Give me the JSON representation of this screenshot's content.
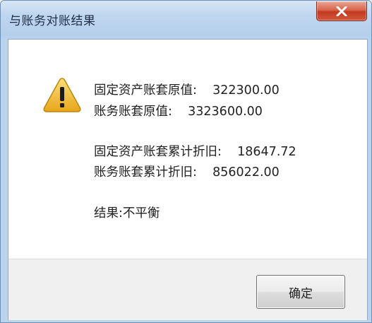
{
  "window": {
    "title": "与账务对账结果",
    "close_label": "x"
  },
  "message": {
    "icon": "warning-icon",
    "fixed_asset_original_value": "固定资产账套原值:    322300.00",
    "account_original_value": "账务账套原值:    3323600.00",
    "fixed_asset_accumulated_depreciation": "固定资产账套累计折旧:    18647.72",
    "account_accumulated_depreciation": "账务账套累计折旧:    856022.00",
    "result": "结果:不平衡"
  },
  "buttons": {
    "ok_label": "确定"
  },
  "colors": {
    "title_bar": "#bfd6ef",
    "close_button": "#c3391f",
    "warning_fill": "#f2c230",
    "dialog_background": "#ffffff",
    "footer_background": "#f0f0f0"
  }
}
